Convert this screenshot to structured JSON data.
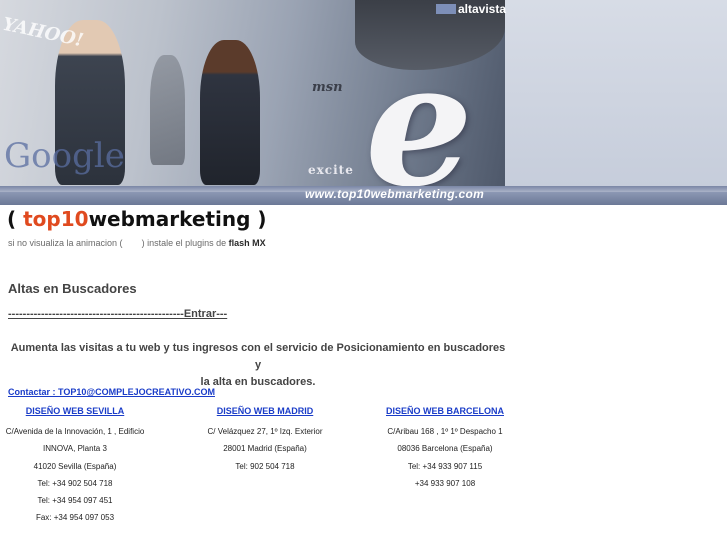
{
  "banner": {
    "logos": {
      "yahoo": "YAHOO!",
      "google": "Google",
      "msn": "msn",
      "excite": "excite",
      "altavista": "altavista"
    },
    "url_text": "www.top10webmarketing.com"
  },
  "brand": {
    "open": "( ",
    "accent": "top10",
    "rest": "webmarketing",
    "close": " )"
  },
  "flash_note": {
    "pre": "si no visualiza la animacion (",
    "post": ") instale el plugins de",
    "bold": "flash MX"
  },
  "heading": "Altas en Buscadores",
  "enter_link": "------------------------------------------------Entrar---",
  "promo": {
    "line1": "Aumenta las visitas a tu web y tus ingresos con el servicio de Posicionamiento en buscadores y",
    "line2": "la alta en buscadores."
  },
  "contact": "Contactar : TOP10@COMPLEJOCREATIVO.COM",
  "offices": [
    {
      "title": "DISEÑO WEB SEVILLA",
      "lines": [
        "C/Avenida de la Innovación, 1 , Edificio",
        "INNOVA, Planta 3",
        "41020 Sevilla (España)",
        "Tel: +34 902 504 718",
        "Tel: +34 954 097 451",
        "Fax: +34 954 097 053"
      ]
    },
    {
      "title": "DISEÑO WEB MADRID",
      "lines": [
        "C/ Velázquez 27, 1º Izq. Exterior",
        "28001 Madrid (España)",
        "Tel: 902 504 718"
      ]
    },
    {
      "title": "DISEÑO WEB BARCELONA",
      "lines": [
        "C/Aribau 168 , 1º 1º Despacho 1",
        "08036 Barcelona (España)",
        "Tel: +34 933 907 115",
        "+34 933 907 108"
      ]
    }
  ]
}
